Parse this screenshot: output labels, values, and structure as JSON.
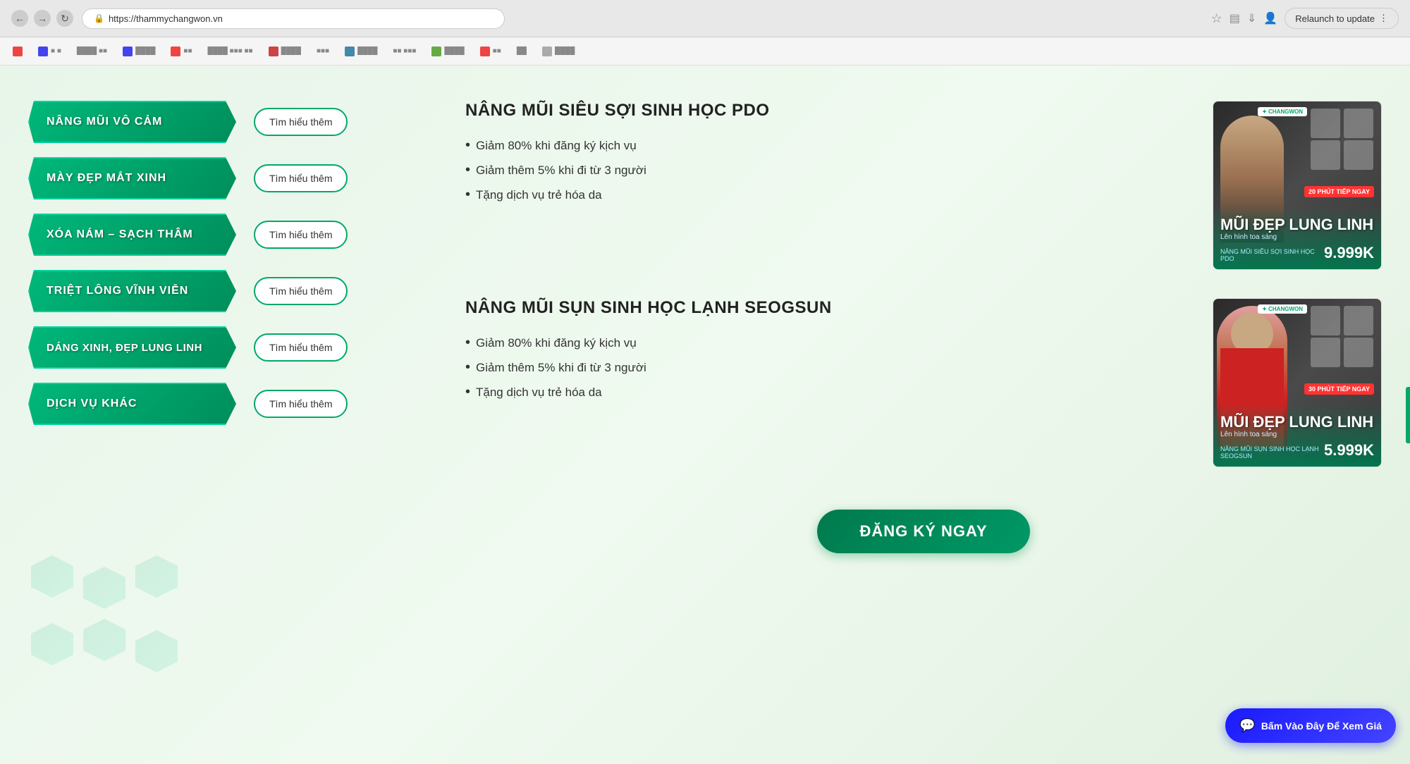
{
  "browser": {
    "url": "https://thammychangwon.vn",
    "relaunch_label": "Relaunch to update"
  },
  "sidebar": {
    "items": [
      {
        "id": "nang-mui-vo-cam",
        "label": "NÂNG MŨI VÔ CẢM",
        "more": "Tìm hiểu thêm"
      },
      {
        "id": "may-dep-mat-xinh",
        "label": "MÀY ĐẸP MẮT XINH",
        "more": "Tìm hiểu thêm"
      },
      {
        "id": "xoa-nam-sach-tham",
        "label": "XÓA NÁM – SẠCH THÂM",
        "more": "Tìm hiểu thêm"
      },
      {
        "id": "triet-long-vinh-vien",
        "label": "TRIỆT LÔNG VĨNH VIỄN",
        "more": "Tìm hiểu thêm"
      },
      {
        "id": "dang-xinh-dep-lung-linh",
        "label": "DÁNG XINH, ĐẸP LUNG LINH",
        "more": "Tìm hiểu thêm"
      },
      {
        "id": "dich-vu-khac",
        "label": "DỊCH VỤ KHÁC",
        "more": "Tìm hiểu thêm"
      }
    ]
  },
  "services": [
    {
      "id": "pdo",
      "title": "NÂNG MŨI SIÊU SỢI SINH HỌC PDO",
      "features": [
        "Giảm 80% khi đăng ký kịch vụ",
        "Giảm thêm 5% khi đi từ 3 người",
        "Tặng dịch vụ trẻ hóa da"
      ],
      "promo": {
        "badge": "TIẾP NGAY",
        "minutes": "20 PHÚT",
        "title1": "MŨI ĐẸP",
        "title2": "LUNG LINH",
        "subtitle": "Lên hình toa sáng",
        "price": "9.999K",
        "service_name": "NÂNG MŨI SIÊU SỢI SINH HỌC PDO"
      }
    },
    {
      "id": "seogsun",
      "title": "NÂNG MŨI SỤN SINH HỌC LẠNH SEOGSUN",
      "features": [
        "Giảm 80% khi đăng ký kịch vụ",
        "Giảm thêm 5% khi đi từ 3 người",
        "Tặng dịch vụ trẻ hóa da"
      ],
      "promo": {
        "badge": "TIẾP NGAY",
        "minutes": "30 PHÚT",
        "title1": "MŨI ĐẸP",
        "title2": "LUNG LINH",
        "subtitle": "Lên hình toa sáng",
        "price": "5.999K",
        "service_name": "NÂNG MŨI SỤN SINH HỌC LẠNH SEOGSUN"
      }
    }
  ],
  "cta": {
    "register_label": "ĐĂNG KÝ NGAY",
    "chat_label": "Bấm Vào Đây Để Xem Giá"
  },
  "brand": {
    "name": "CHANGWON",
    "color_primary": "#00a86b",
    "color_dark": "#007a4d"
  }
}
